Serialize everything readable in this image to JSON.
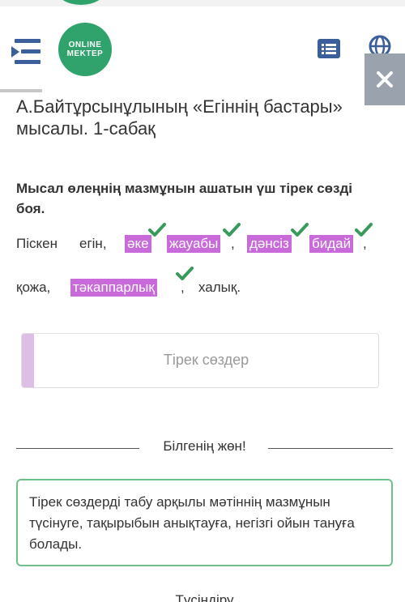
{
  "header": {
    "logo_line1": "ONLINE",
    "logo_line2": "MEKTEP",
    "menu_icon": "hamburger-menu-icon",
    "list_icon": "list-icon",
    "globe_icon": "globe-icon",
    "close_icon": "close-icon",
    "brand_color": "#2fa36b",
    "icon_color": "#3b5f9a"
  },
  "lesson": {
    "title": "А.Байтұрсынұлының «Егіннің бастары» мысалы. 1-сабақ"
  },
  "task": {
    "question": "Мысал өлеңнің мазмұнын ашатын үш тірек сөзді боя.",
    "highlight_color": "#c86ad9",
    "words": [
      {
        "text": "Піскен",
        "selected": false
      },
      {
        "text": "егін,",
        "selected": false
      },
      {
        "text": "әке",
        "selected": true,
        "checked": true
      },
      {
        "text": "жауабы",
        "selected": true,
        "checked": true
      },
      {
        "text": ",",
        "selected": false
      },
      {
        "text": "дәнсіз",
        "selected": true,
        "checked": true
      },
      {
        "text": "бидай",
        "selected": true,
        "checked": true
      },
      {
        "text": ",",
        "selected": false
      },
      {
        "text": "қожа,",
        "selected": false
      },
      {
        "text": "тәкаппарлық",
        "selected": true,
        "checked": true
      },
      {
        "text": ",",
        "selected": false
      },
      {
        "text": "халық.",
        "selected": false
      }
    ],
    "drop_zone_label": "Тірек сөздер"
  },
  "knowledge": {
    "divider_label": "Білгенің жөн!",
    "text": "Тірек сөздерді табу арқылы мәтіннің мазмұнын түсінуге, тақырыбын анықтауға, негізгі ойын тануға болады."
  },
  "next_section": {
    "divider_label": "Түсіндіру"
  }
}
